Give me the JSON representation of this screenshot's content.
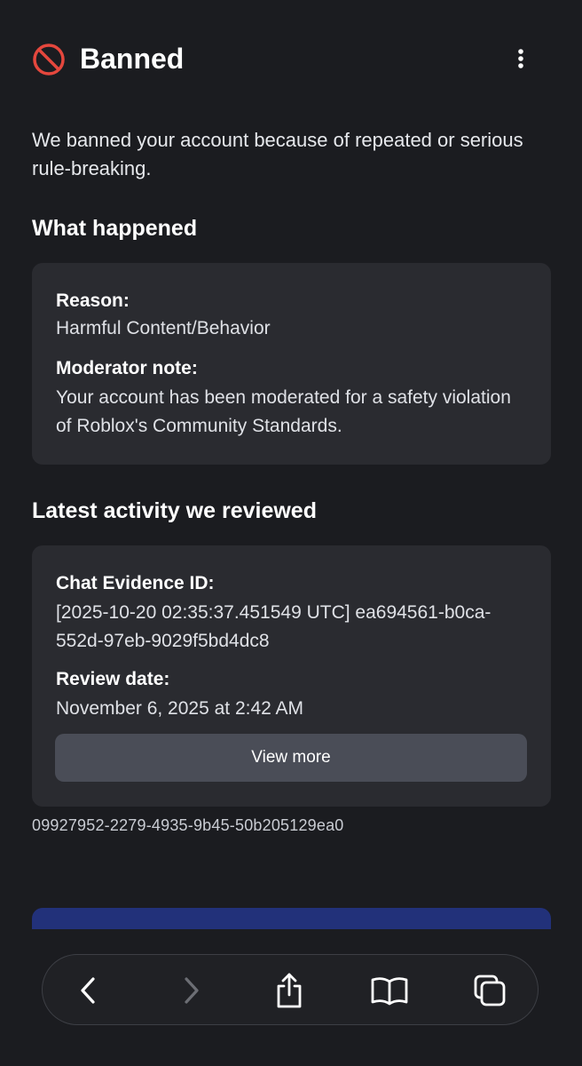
{
  "header": {
    "title": "Banned",
    "icon": "ban-icon",
    "menu_icon": "more-vertical-icon",
    "accent_color": "#e5473d"
  },
  "intro_text": "We banned your account because of repeated or serious rule-breaking.",
  "what_happened": {
    "heading": "What happened",
    "reason_label": "Reason:",
    "reason_value": "Harmful Content/Behavior",
    "note_label": "Moderator note:",
    "note_value": "Your account has been moderated for a safety violation of Roblox's Community Standards."
  },
  "latest_activity": {
    "heading": "Latest activity we reviewed",
    "evidence_label": "Chat Evidence ID:",
    "evidence_value": "[2025-10-20 02:35:37.451549 UTC] ea694561-b0ca-552d-97eb-9029f5bd4dc8",
    "review_label": "Review date:",
    "review_value": "November 6, 2025 at 2:42 AM",
    "view_more_label": "View more"
  },
  "reference_id": "09927952-2279-4935-9b45-50b205129ea0",
  "browser_toolbar": {
    "buttons": [
      "back-icon",
      "forward-icon",
      "share-icon",
      "bookmarks-icon",
      "tabs-icon"
    ]
  }
}
